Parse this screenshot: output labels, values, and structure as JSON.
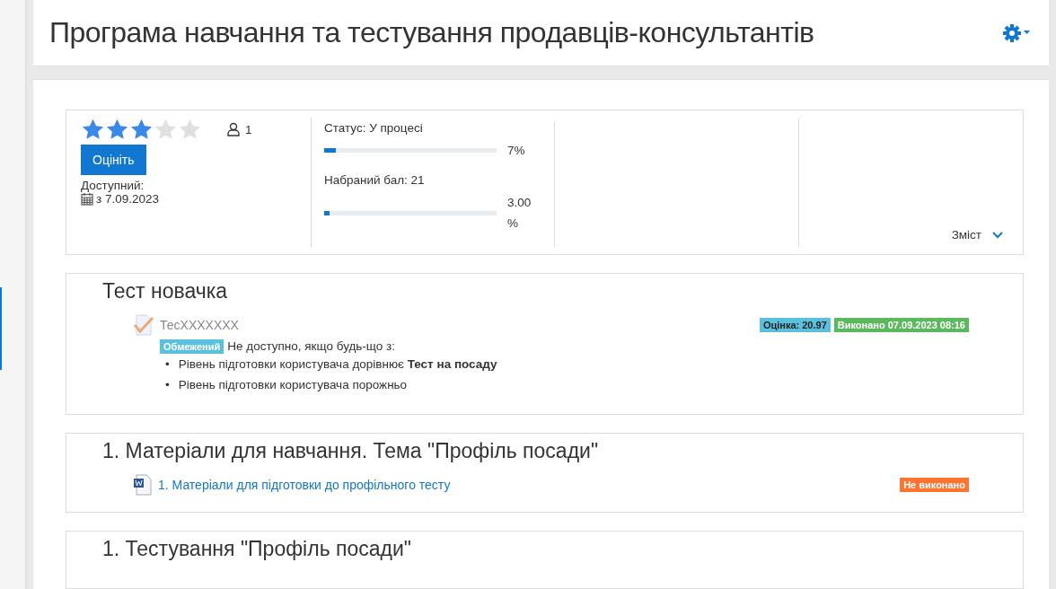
{
  "page_title": "Програма навчання та тестування продавців-консультантів",
  "summary": {
    "stars": 3,
    "rate_button": "Оцініть",
    "participants": "1",
    "available_label": "Доступний:",
    "available_date": "з 7.09.2023",
    "progress": [
      {
        "label": "Статус: У процесі",
        "level": 0.07,
        "reading": "7%"
      },
      {
        "label": "Набраний бал: 21",
        "level": 0.03,
        "reading": "3.00 %"
      }
    ],
    "contents_toggle": "Зміст"
  },
  "sections": [
    {
      "title": "Тест новачка",
      "activities": [
        {
          "kind": "quiz",
          "name": "ТесXXXXXXX",
          "badges": [
            {
              "text": "Оцінка: 20.97",
              "color": "#5bc0de"
            },
            {
              "text": "Виконано 07.09.2023 08:16",
              "color": "#5cb85c"
            }
          ],
          "restriction": {
            "label": "Обмежений",
            "text": "Не доступно, якщо будь-що з:",
            "conditions": [
              {
                "marker": "•",
                "text": "Рівень підготовки користувача дорівнює **Тест на посаду**"
              },
              {
                "marker": "•",
                "text": "Рівень підготовки користувача порожньо"
              }
            ]
          }
        }
      ]
    },
    {
      "title": "1. Матеріали для навчання. Тема \"Профіль посади\"",
      "activities": [
        {
          "kind": "document",
          "name": "1. Матеріали для підготовки до профільного тесту",
          "badges": [
            {
              "text": "Не виконано",
              "color": "#ff7430"
            }
          ]
        }
      ]
    },
    {
      "title": "1. Тестування \"Профіль посади\""
    }
  ]
}
